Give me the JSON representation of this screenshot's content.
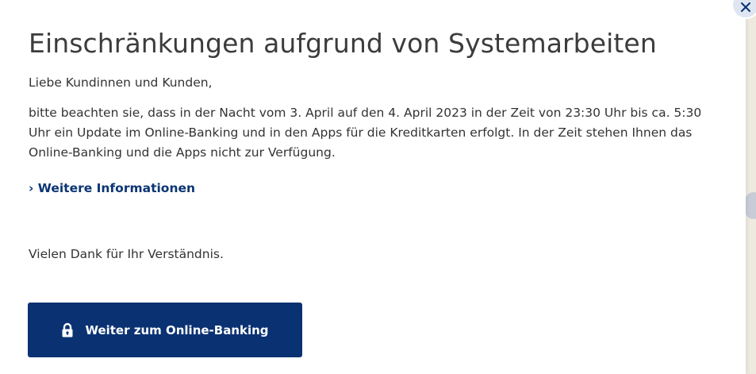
{
  "modal": {
    "title": "Einschränkungen aufgrund von Systemarbeiten",
    "greeting": "Liebe Kundinnen und Kunden,",
    "body": "bitte beachten sie, dass in der Nacht vom 3. April auf den 4. April 2023 in der Zeit von 23:30 Uhr bis ca. 5:30 Uhr ein Update im Online-Banking und in den Apps für die Kreditkarten erfolgt. In der Zeit stehen Ihnen das Online-Banking und die Apps nicht zur Verfügung.",
    "info_link": "› Weitere Informationen",
    "thanks": "Vielen Dank für Ihr Verständnis.",
    "cta_label": "Weiter zum Online-Banking"
  },
  "icons": {
    "cta_icon": "lock-icon",
    "close_icon": "close-icon"
  },
  "colors": {
    "primary": "#0a3273",
    "link": "#0a3573",
    "text": "#333333",
    "title": "#3c3c3c"
  }
}
